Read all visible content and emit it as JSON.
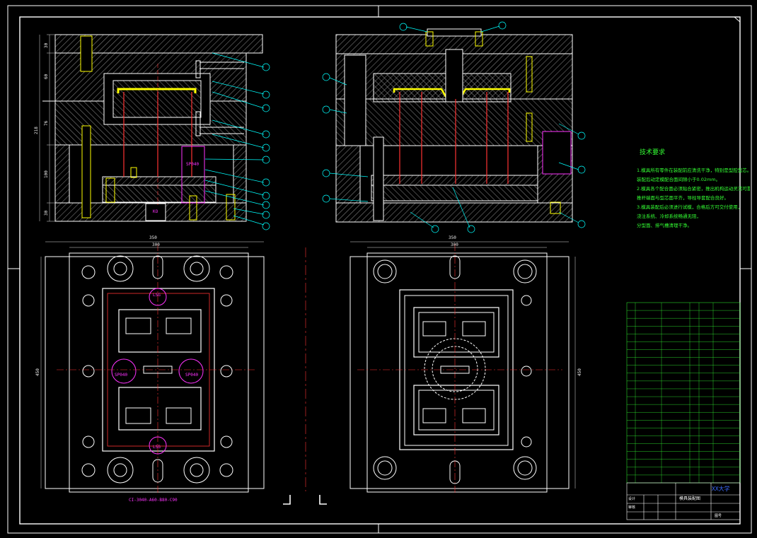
{
  "technical_requirements": {
    "title": "技术要求",
    "lines": [
      "1.模具所有零件在装配前应清洗干净，特别是型腔型芯。",
      "  装配后动定模配合面间隙小于0.02mm。",
      "2.模具各个配合面必须贴合紧密，推出机构运动灵活可靠，",
      "  推杆端面与型芯面平齐，导柱导套配合良好。",
      "3.模具装配后必须进行试模，合格后方可交付使用，",
      "  浇注系统、冷却系统畅通无阻，",
      "  分型面、排气槽清理干净。"
    ]
  },
  "dimensions": {
    "plan_left_outer": "350",
    "plan_left_inner": "300",
    "plan_right_outer": "350",
    "plan_right_inner": "300",
    "plan_left_height": "450",
    "plan_right_height": "450",
    "sec_total": "218",
    "sec_top": "30",
    "sec_a": "60",
    "sec_b": "76",
    "sec_c": "100",
    "sec_bot": "30"
  },
  "labels": {
    "sp_top": "SP040",
    "ko": "KO",
    "sp_left": "SP040",
    "sp_right": "SP040",
    "part_code": "CI-3040-A60-B80-C90",
    "ld_top": "LSG",
    "ld_bot": "LSG"
  },
  "title_block": {
    "school": "XX大学",
    "drawing_name": "模具装配图",
    "designer": "设计",
    "checker": "审核",
    "drawing_no": "图号"
  },
  "colors": {
    "border": "#ffffff",
    "hatch": "#dddddd",
    "cyan": "#00ffff",
    "magenta": "#ff33ff",
    "red": "#ff3333",
    "yellow": "#ffff00",
    "green": "#33ff33"
  }
}
